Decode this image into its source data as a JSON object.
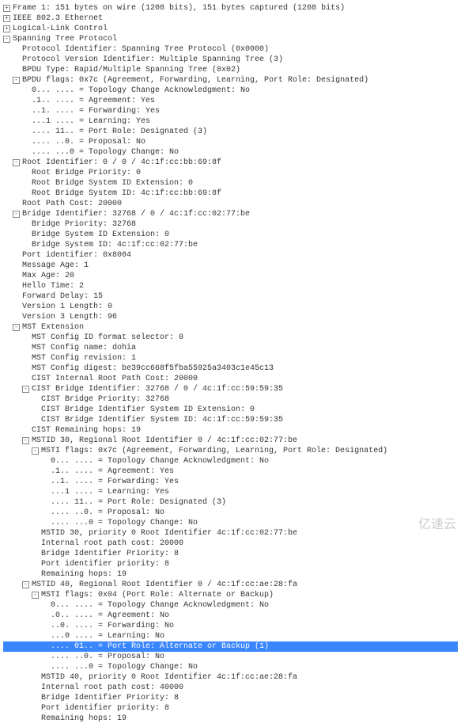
{
  "rows": [
    {
      "d": 0,
      "t": "plus",
      "txt": "Frame 1: 151 bytes on wire (1208 bits), 151 bytes captured (1208 bits)"
    },
    {
      "d": 0,
      "t": "plus",
      "txt": "IEEE 802.3 Ethernet"
    },
    {
      "d": 0,
      "t": "plus",
      "txt": "Logical-Link Control"
    },
    {
      "d": 0,
      "t": "minus",
      "txt": "Spanning Tree Protocol"
    },
    {
      "d": 1,
      "t": "none",
      "txt": "Protocol Identifier: Spanning Tree Protocol (0x0000)"
    },
    {
      "d": 1,
      "t": "none",
      "txt": "Protocol Version Identifier: Multiple Spanning Tree (3)"
    },
    {
      "d": 1,
      "t": "none",
      "txt": "BPDU Type: Rapid/Multiple Spanning Tree (0x02)"
    },
    {
      "d": 1,
      "t": "minus",
      "txt": "BPDU flags: 0x7c (Agreement, Forwarding, Learning, Port Role: Designated)"
    },
    {
      "d": 2,
      "t": "none",
      "txt": "0... .... = Topology Change Acknowledgment: No"
    },
    {
      "d": 2,
      "t": "none",
      "txt": ".1.. .... = Agreement: Yes"
    },
    {
      "d": 2,
      "t": "none",
      "txt": "..1. .... = Forwarding: Yes"
    },
    {
      "d": 2,
      "t": "none",
      "txt": "...1 .... = Learning: Yes"
    },
    {
      "d": 2,
      "t": "none",
      "txt": ".... 11.. = Port Role: Designated (3)"
    },
    {
      "d": 2,
      "t": "none",
      "txt": ".... ..0. = Proposal: No"
    },
    {
      "d": 2,
      "t": "none",
      "txt": ".... ...0 = Topology Change: No"
    },
    {
      "d": 1,
      "t": "minus",
      "txt": "Root Identifier: 0 / 0 / 4c:1f:cc:bb:69:8f"
    },
    {
      "d": 2,
      "t": "none",
      "txt": "Root Bridge Priority: 0"
    },
    {
      "d": 2,
      "t": "none",
      "txt": "Root Bridge System ID Extension: 0"
    },
    {
      "d": 2,
      "t": "none",
      "txt": "Root Bridge System ID: 4c:1f:cc:bb:69:8f"
    },
    {
      "d": 1,
      "t": "none",
      "txt": "Root Path Cost: 20000"
    },
    {
      "d": 1,
      "t": "minus",
      "txt": "Bridge Identifier: 32768 / 0 / 4c:1f:cc:02:77:be"
    },
    {
      "d": 2,
      "t": "none",
      "txt": "Bridge Priority: 32768"
    },
    {
      "d": 2,
      "t": "none",
      "txt": "Bridge System ID Extension: 0"
    },
    {
      "d": 2,
      "t": "none",
      "txt": "Bridge System ID: 4c:1f:cc:02:77:be"
    },
    {
      "d": 1,
      "t": "none",
      "txt": "Port identifier: 0x8004"
    },
    {
      "d": 1,
      "t": "none",
      "txt": "Message Age: 1"
    },
    {
      "d": 1,
      "t": "none",
      "txt": "Max Age: 20"
    },
    {
      "d": 1,
      "t": "none",
      "txt": "Hello Time: 2"
    },
    {
      "d": 1,
      "t": "none",
      "txt": "Forward Delay: 15"
    },
    {
      "d": 1,
      "t": "none",
      "txt": "Version 1 Length: 0"
    },
    {
      "d": 1,
      "t": "none",
      "txt": "Version 3 Length: 96"
    },
    {
      "d": 1,
      "t": "minus",
      "txt": "MST Extension"
    },
    {
      "d": 2,
      "t": "none",
      "txt": "MST Config ID format selector: 0"
    },
    {
      "d": 2,
      "t": "none",
      "txt": "MST Config name: dohia"
    },
    {
      "d": 2,
      "t": "none",
      "txt": "MST Config revision: 1"
    },
    {
      "d": 2,
      "t": "none",
      "txt": "MST Config digest: be39cc668f5fba55925a3403c1e45c13"
    },
    {
      "d": 2,
      "t": "none",
      "txt": "CIST Internal Root Path Cost: 20000"
    },
    {
      "d": 2,
      "t": "minus",
      "txt": "CIST Bridge Identifier: 32768 / 0 / 4c:1f:cc:59:59:35"
    },
    {
      "d": 3,
      "t": "none",
      "txt": "CIST Bridge Priority: 32768"
    },
    {
      "d": 3,
      "t": "none",
      "txt": "CIST Bridge Identifier System ID Extension: 0"
    },
    {
      "d": 3,
      "t": "none",
      "txt": "CIST Bridge Identifier System ID: 4c:1f:cc:59:59:35"
    },
    {
      "d": 2,
      "t": "none",
      "txt": "CIST Remaining hops: 19"
    },
    {
      "d": 2,
      "t": "minus",
      "txt": "MSTID 30, Regional Root Identifier 0 / 4c:1f:cc:02:77:be"
    },
    {
      "d": 3,
      "t": "minus",
      "txt": "MSTI flags: 0x7c (Agreement, Forwarding, Learning, Port Role: Designated)"
    },
    {
      "d": 4,
      "t": "none",
      "txt": "0... .... = Topology Change Acknowledgment: No"
    },
    {
      "d": 4,
      "t": "none",
      "txt": ".1.. .... = Agreement: Yes"
    },
    {
      "d": 4,
      "t": "none",
      "txt": "..1. .... = Forwarding: Yes"
    },
    {
      "d": 4,
      "t": "none",
      "txt": "...1 .... = Learning: Yes"
    },
    {
      "d": 4,
      "t": "none",
      "txt": ".... 11.. = Port Role: Designated (3)"
    },
    {
      "d": 4,
      "t": "none",
      "txt": ".... ..0. = Proposal: No"
    },
    {
      "d": 4,
      "t": "none",
      "txt": ".... ...0 = Topology Change: No"
    },
    {
      "d": 3,
      "t": "none",
      "txt": "MSTID 30, priority 0 Root Identifier 4c:1f:cc:02:77:be"
    },
    {
      "d": 3,
      "t": "none",
      "txt": "Internal root path cost: 20000"
    },
    {
      "d": 3,
      "t": "none",
      "txt": "Bridge Identifier Priority: 8"
    },
    {
      "d": 3,
      "t": "none",
      "txt": "Port identifier priority: 8"
    },
    {
      "d": 3,
      "t": "none",
      "txt": "Remaining hops: 19"
    },
    {
      "d": 2,
      "t": "minus",
      "txt": "MSTID 40, Regional Root Identifier 0 / 4c:1f:cc:ae:28:fa"
    },
    {
      "d": 3,
      "t": "minus",
      "txt": "MSTI flags: 0x04 (Port Role: Alternate or Backup)"
    },
    {
      "d": 4,
      "t": "none",
      "txt": "0... .... = Topology Change Acknowledgment: No"
    },
    {
      "d": 4,
      "t": "none",
      "txt": ".0.. .... = Agreement: No"
    },
    {
      "d": 4,
      "t": "none",
      "txt": "..0. .... = Forwarding: No"
    },
    {
      "d": 4,
      "t": "none",
      "txt": "...0 .... = Learning: No"
    },
    {
      "d": 4,
      "t": "none",
      "txt": ".... 01.. = Port Role: Alternate or Backup (1)",
      "sel": true
    },
    {
      "d": 4,
      "t": "none",
      "txt": ".... ..0. = Proposal: No"
    },
    {
      "d": 4,
      "t": "none",
      "txt": ".... ...0 = Topology Change: No"
    },
    {
      "d": 3,
      "t": "none",
      "txt": "MSTID 40, priority 0 Root Identifier 4c:1f:cc:ae:28:fa"
    },
    {
      "d": 3,
      "t": "none",
      "txt": "Internal root path cost: 40000"
    },
    {
      "d": 3,
      "t": "none",
      "txt": "Bridge Identifier Priority: 8"
    },
    {
      "d": 3,
      "t": "none",
      "txt": "Port identifier priority: 8"
    },
    {
      "d": 3,
      "t": "none",
      "txt": "Remaining hops: 19"
    }
  ],
  "watermark": "亿速云"
}
